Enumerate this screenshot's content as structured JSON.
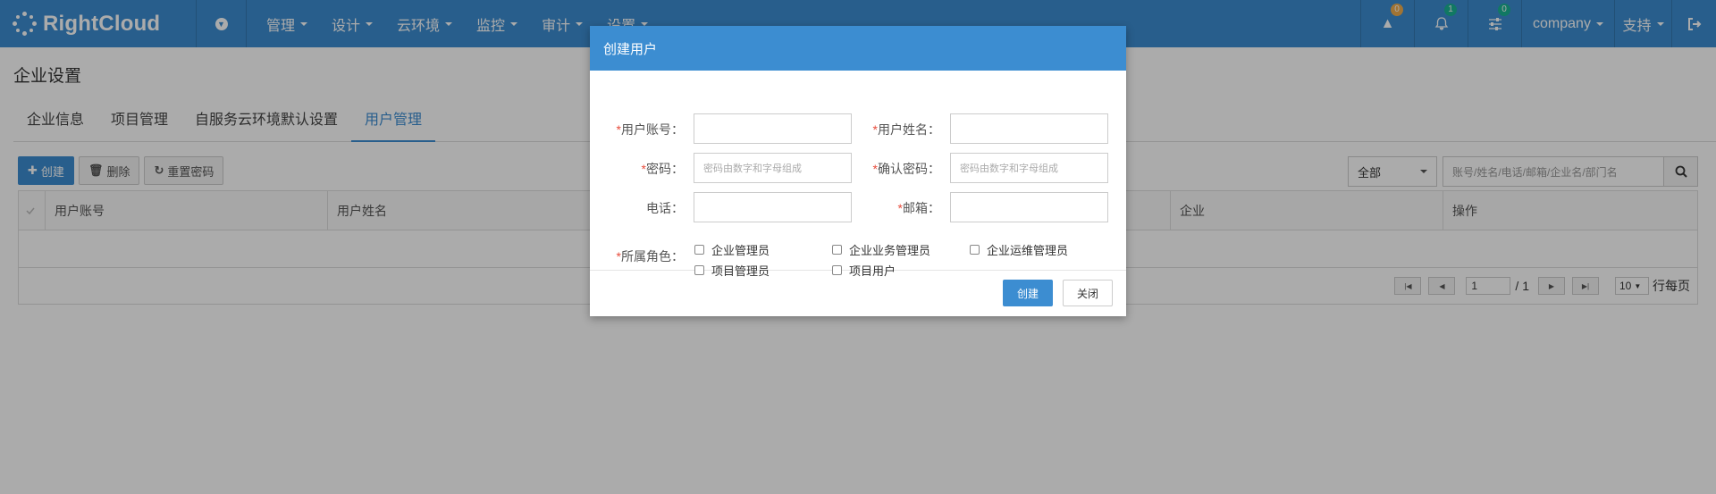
{
  "app": {
    "brand": "RightCloud"
  },
  "topnav": {
    "menu": [
      {
        "label": "管理"
      },
      {
        "label": "设计"
      },
      {
        "label": "云环境"
      },
      {
        "label": "监控"
      },
      {
        "label": "审计"
      },
      {
        "label": "设置"
      }
    ],
    "alerts_count": "0",
    "notifications_count": "1",
    "tasks_count": "0",
    "company_label": "company",
    "support_label": "支持"
  },
  "page": {
    "title": "企业设置",
    "tabs": [
      {
        "label": "企业信息"
      },
      {
        "label": "项目管理"
      },
      {
        "label": "自服务云环境默认设置"
      },
      {
        "label": "用户管理",
        "active": true
      }
    ]
  },
  "toolbar": {
    "create_label": "创建",
    "delete_label": "删除",
    "reset_password_label": "重置密码"
  },
  "filter": {
    "scope_value": "全部",
    "search_placeholder": "账号/姓名/电话/邮箱/企业名/部门名"
  },
  "grid": {
    "columns": [
      "用户账号",
      "用户姓名",
      "企业",
      "操作"
    ]
  },
  "pager": {
    "current_page": "1",
    "total_pages": "/ 1",
    "page_size": "10",
    "per_page_label": "行每页"
  },
  "modal": {
    "title": "创建用户",
    "fields": {
      "account_label": "用户账号：",
      "name_label": "用户姓名：",
      "password_label": "密码：",
      "password_placeholder": "密码由数字和字母组成",
      "confirm_label": "确认密码：",
      "confirm_placeholder": "密码由数字和字母组成",
      "phone_label": "电话：",
      "email_label": "邮箱：",
      "role_label": "所属角色："
    },
    "roles": [
      "企业管理员",
      "企业业务管理员",
      "企业运维管理员",
      "项目管理员",
      "项目用户"
    ],
    "create_button": "创建",
    "close_button": "关闭"
  }
}
